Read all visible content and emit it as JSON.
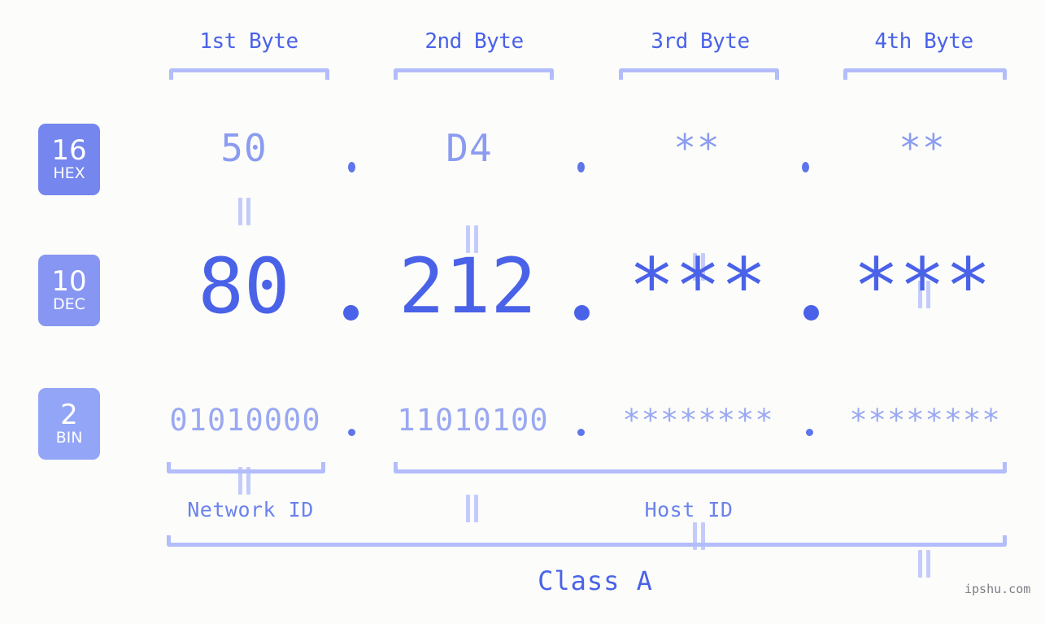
{
  "background_color": "#fcfdfa",
  "accent_color": "#4a62e8",
  "accent_light": "#b3bdfb",
  "headers": [
    {
      "label": "1st Byte"
    },
    {
      "label": "2nd Byte"
    },
    {
      "label": "3rd Byte"
    },
    {
      "label": "4th Byte"
    }
  ],
  "bases": [
    {
      "number": "16",
      "name": "HEX",
      "color": "#7586ee"
    },
    {
      "number": "10",
      "name": "DEC",
      "color": "#8796f2"
    },
    {
      "number": "2",
      "name": "BIN",
      "color": "#93a5f7"
    }
  ],
  "rows": {
    "hex": {
      "base": "16",
      "values": [
        "50",
        "D4",
        "**",
        "**"
      ],
      "separator": "."
    },
    "dec": {
      "base": "10",
      "values": [
        "80",
        "212",
        "***",
        "***"
      ],
      "separator": "."
    },
    "bin": {
      "base": "2",
      "values": [
        "01010000",
        "11010100",
        "********",
        "********"
      ],
      "separator": "."
    }
  },
  "connectors": {
    "symbol": "=",
    "count": 4,
    "rows": 2
  },
  "id_labels": {
    "network": "Network ID",
    "host": "Host ID"
  },
  "class_label": "Class A",
  "watermark": "ipshu.com"
}
